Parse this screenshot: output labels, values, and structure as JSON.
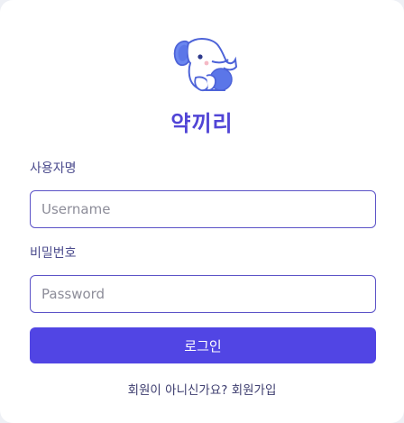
{
  "app": {
    "title": "약끼리",
    "logo": "elephant-logo-icon"
  },
  "form": {
    "username_label": "사용자명",
    "username_placeholder": "Username",
    "username_value": "",
    "password_label": "비밀번호",
    "password_placeholder": "Password",
    "password_value": "",
    "login_label": "로그인"
  },
  "footer": {
    "prompt": "회원이 아니신가요?",
    "signup_label": "회원가입"
  },
  "colors": {
    "accent": "#5145e4",
    "title": "#5145d6",
    "logo_blue": "#5b76e8",
    "input_border": "#5b52c7"
  }
}
